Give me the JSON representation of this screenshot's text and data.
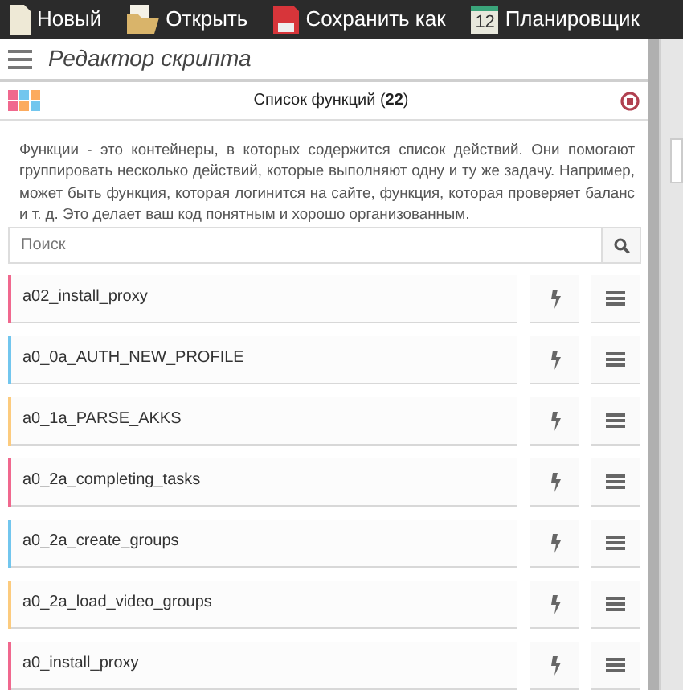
{
  "toolbar": [
    {
      "kind": "new",
      "label": "Новый"
    },
    {
      "kind": "open",
      "label": "Открыть"
    },
    {
      "kind": "save",
      "label": "Сохранить как"
    },
    {
      "kind": "calendar",
      "label": "Планировщик",
      "icon_text": "12"
    }
  ],
  "header": {
    "title": "Редактор скрипта"
  },
  "panel": {
    "title": "Список функций (**22**)",
    "description": "Функции - это контейнеры, в которых содержится список действий. Они помогают группировать несколько действий, которые выполняют одну и ту же задачу. Например, может быть функция, которая логинится на сайте, функция, которая проверяет баланс и т. д. Это делает ваш код понятным и хорошо организованным.",
    "search": {
      "placeholder": "Поиск"
    }
  },
  "functions": [
    {
      "name": "a02_install_proxy",
      "color": "#f0688e"
    },
    {
      "name": "a0_0a_AUTH_NEW_PROFILE",
      "color": "#72c6ee"
    },
    {
      "name": "a0_1a_PARSE_AKKS",
      "color": "#fccb7e"
    },
    {
      "name": "a0_2a_completing_tasks",
      "color": "#f0688e"
    },
    {
      "name": "a0_2a_create_groups",
      "color": "#72c6ee"
    },
    {
      "name": "a0_2a_load_video_groups",
      "color": "#fccb7e"
    },
    {
      "name": "a0_install_proxy",
      "color": "#f0688e"
    }
  ]
}
